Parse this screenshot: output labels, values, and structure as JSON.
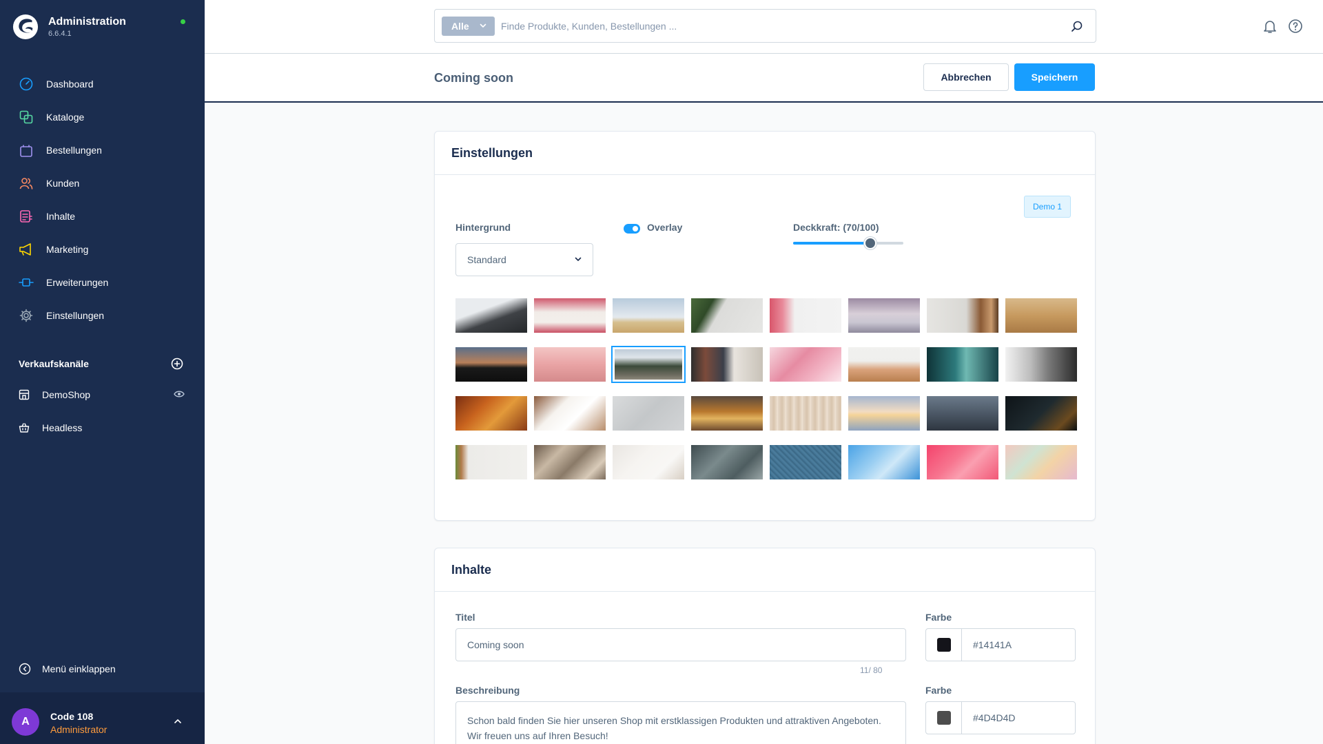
{
  "app": {
    "title": "Administration",
    "version": "6.6.4.1",
    "status_color": "#37d046"
  },
  "sidebar": {
    "items": [
      {
        "label": "Dashboard",
        "icon": "dashboard-icon",
        "color": "#189eff"
      },
      {
        "label": "Kataloge",
        "icon": "catalog-icon",
        "color": "#57d9a3"
      },
      {
        "label": "Bestellungen",
        "icon": "orders-bag-icon",
        "color": "#a092f0"
      },
      {
        "label": "Kunden",
        "icon": "customers-icon",
        "color": "#f88962"
      },
      {
        "label": "Inhalte",
        "icon": "content-icon",
        "color": "#ff68b4"
      },
      {
        "label": "Marketing",
        "icon": "marketing-megaphone-icon",
        "color": "#ffd700"
      },
      {
        "label": "Erweiterungen",
        "icon": "extensions-plug-icon",
        "color": "#189eff"
      },
      {
        "label": "Einstellungen",
        "icon": "settings-gear-icon",
        "color": "#9aa8b5"
      }
    ],
    "sales_channels_title": "Verkaufskanäle",
    "channels": [
      {
        "label": "DemoShop",
        "icon": "storefront-icon"
      },
      {
        "label": "Headless",
        "icon": "basket-icon"
      }
    ],
    "collapse_label": "Menü einklappen"
  },
  "user": {
    "initial": "A",
    "name": "Code 108",
    "role": "Administrator"
  },
  "search": {
    "type_label": "Alle",
    "placeholder": "Finde Produkte, Kunden, Bestellungen ..."
  },
  "smartbar": {
    "title": "Coming soon",
    "cancel_label": "Abbrechen",
    "save_label": "Speichern"
  },
  "settings_card": {
    "title": "Einstellungen",
    "demo_label": "Demo 1",
    "background_label": "Hintergrund",
    "background_value": "Standard",
    "overlay_label": "Overlay",
    "overlay_on": true,
    "opacity_label": "Deckkraft: (70/100)",
    "opacity_value": 70,
    "selected_index": 10,
    "images": [
      {
        "name": "misty-mountain",
        "bg": "linear-gradient(160deg,#e9ecef 35%,#3f4246 60%,#25282b 100%)"
      },
      {
        "name": "flowers-frame",
        "bg": "linear-gradient(180deg,#d05a6e 0%,#f1ece8 40%,#f3efeb 70%,#c94f63 100%)"
      },
      {
        "name": "field-sky",
        "bg": "linear-gradient(180deg,#b8cbdc 0%,#e4e9ee 55%,#d6bf8e 70%,#c9a66c 100%)"
      },
      {
        "name": "plant-grey",
        "bg": "linear-gradient(120deg,#4a6a3b 0%,#2f4a28 25%,#dcdcda 40%,#e6e6e4 100%)"
      },
      {
        "name": "pink-flower-corner",
        "bg": "linear-gradient(90deg,#d9566b 0%,#e88a9a 18%,#f0f0f0 35%,#f3f3f3 100%)"
      },
      {
        "name": "flamingo-lake",
        "bg": "linear-gradient(180deg,#9c8aa3 0%,#d8cfd8 45%,#c9c6d2 70%,#8f8a9c 100%)"
      },
      {
        "name": "woman-fog",
        "bg": "linear-gradient(90deg,#e6e5e2 0%,#d9d8d4 55%,#8a5a35 75%,#c99a6e 90%,#5a3b22 100%)"
      },
      {
        "name": "wheat",
        "bg": "linear-gradient(180deg,#d8b98a 0%,#c79a5f 50%,#a97a45 100%)"
      },
      {
        "name": "sunset-mountain",
        "bg": "linear-gradient(180deg,#5a6f8a 0%,#b8805a 45%,#1a1a1a 60%,#0e0e0e 100%)"
      },
      {
        "name": "pink-hills",
        "bg": "linear-gradient(180deg,#f3c5c4 0%,#e9a4a5 50%,#d58a8c 100%)"
      },
      {
        "name": "alpine-forest",
        "bg": "linear-gradient(180deg,#b8c6d4 0%,#dfe5ea 30%,#3b4a3a 55%,#6b6a5e 80%,#9a9487 100%)"
      },
      {
        "name": "clothing-rack",
        "bg": "linear-gradient(90deg,#2e2e2e 0%,#7c4b3b 20%,#3a3f4a 45%,#e8e4de 60%,#c8c2b8 100%)"
      },
      {
        "name": "pink-lily",
        "bg": "linear-gradient(135deg,#f6d7df 0%,#e68ba2 40%,#f2b4c4 70%,#fbe5eb 100%)"
      },
      {
        "name": "poppy-field",
        "bg": "linear-gradient(180deg,#f1f1ef 0%,#efefed 40%,#d9a27b 65%,#b97f4e 100%)"
      },
      {
        "name": "teal-forest",
        "bg": "linear-gradient(90deg,#0f3337 0%,#2d7a7c 40%,#6fb9b2 55%,#174248 100%)"
      },
      {
        "name": "white-fabric",
        "bg": "linear-gradient(90deg,#f2f2f2 0%,#bdbdbd 35%,#7a7a7a 60%,#2b2b2b 100%)"
      },
      {
        "name": "autumn-leaves",
        "bg": "linear-gradient(135deg,#7a2e12 0%,#c8631e 35%,#e39a3a 60%,#8a3a15 100%)"
      },
      {
        "name": "gift-boxes",
        "bg": "linear-gradient(135deg,#8a5a3c 0%,#f6f3ef 35%,#ffffff 60%,#b88e6c 100%)"
      },
      {
        "name": "concrete-grey",
        "bg": "linear-gradient(135deg,#d9dbdc 0%,#c4c7c9 50%,#d2d4d6 100%)"
      },
      {
        "name": "autumn-bokeh",
        "bg": "linear-gradient(180deg,#5a4a3e 0%,#b9782e 45%,#e2b35f 65%,#6e4a2e 100%)"
      },
      {
        "name": "beige-curtains",
        "bg": "repeating-linear-gradient(90deg,#e6d8c8 0,#d8c4ad 6px,#efe3d4 12px)"
      },
      {
        "name": "beach-sunset",
        "bg": "linear-gradient(180deg,#a6b6cf 0%,#f2dcc2 45%,#f5d398 55%,#8ea3bf 100%)"
      },
      {
        "name": "foggy-forest",
        "bg": "linear-gradient(180deg,#6b7a8a 0%,#4c5866 50%,#2e3640 100%)"
      },
      {
        "name": "fairy-lights",
        "bg": "linear-gradient(135deg,#0e1418 0%,#1f2a2f 50%,#6b4a1f 80%,#0b0f12 100%)"
      },
      {
        "name": "cactus-wall",
        "bg": "linear-gradient(90deg,#6b8a3a 0%,#b07a4a 8%,#ecebe8 18%,#f1f0ed 100%)"
      },
      {
        "name": "palm-shadow",
        "bg": "linear-gradient(135deg,#6b5a4a 0%,#c8b8a4 30%,#8a7a68 55%,#d9cbb9 80%,#7a6a5a 100%)"
      },
      {
        "name": "dried-flowers-white",
        "bg": "linear-gradient(135deg,#e9e6e2 0%,#f6f4f1 40%,#f8f7f5 70%,#d8cfc4 100%)"
      },
      {
        "name": "frosted-leaves",
        "bg": "linear-gradient(135deg,#3e4c4f 0%,#7a8a8c 40%,#4e5d60 70%,#9aa6a7 100%)"
      },
      {
        "name": "blue-denim",
        "bg": "repeating-linear-gradient(45deg,#3f6f8f 0,#4d7f9f 3px,#36627f 6px)"
      },
      {
        "name": "blue-sky-clouds",
        "bg": "linear-gradient(135deg,#4aa3e6 0%,#9ccff2 40%,#cfe8f8 60%,#3b92d8 100%)"
      },
      {
        "name": "pink-smoke",
        "bg": "linear-gradient(135deg,#f4436c 0%,#f7758f 40%,#fa9fb0 60%,#f25877 100%)"
      },
      {
        "name": "pastel-watercolor",
        "bg": "linear-gradient(135deg,#f2c9c0 0%,#cfe3d2 35%,#f3d3a6 60%,#e6b9cf 100%)"
      }
    ]
  },
  "content_card": {
    "title": "Inhalte",
    "title_label": "Titel",
    "title_value": "Coming soon",
    "title_counter": "11/ 80",
    "color_label": "Farbe",
    "title_color_value": "#14141A",
    "title_color": "#14141A",
    "description_label": "Beschreibung",
    "description_value": "Schon bald finden Sie hier unseren Shop mit erstklassigen Produkten und attraktiven Angeboten. Wir freuen uns auf Ihren Besuch!",
    "description_color_label": "Farbe",
    "description_color_value": "#4D4D4D",
    "description_color": "#4D4D4D"
  }
}
